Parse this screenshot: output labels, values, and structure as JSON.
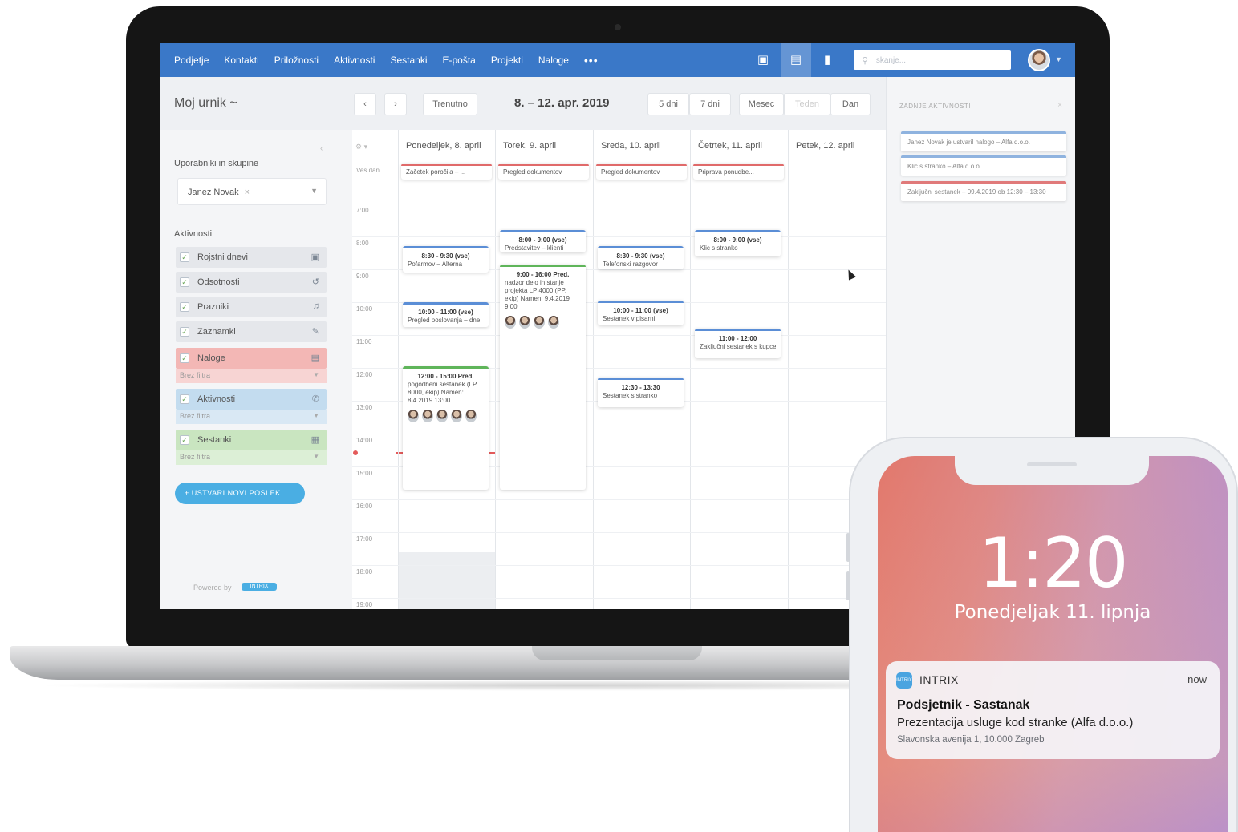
{
  "nav": {
    "items": [
      "Podjetje",
      "Kontakti",
      "Priložnosti",
      "Aktivnosti",
      "Sestanki",
      "E-pošta",
      "Projekti",
      "Naloge"
    ],
    "more": "•••",
    "search_placeholder": "Iskanje..."
  },
  "toolbar": {
    "title": "Moj urnik ~",
    "prev": "‹",
    "next": "›",
    "today": "Trenutno",
    "range": "8. – 12. apr. 2019",
    "views": [
      "5 dni",
      "7 dni",
      "Mesec",
      "Teden",
      "Dan"
    ]
  },
  "sidebar": {
    "users_heading": "Uporabniki in skupine",
    "collapse": "‹",
    "selected_user": "Janez Novak",
    "activities_heading": "Aktivnosti",
    "activities": [
      {
        "label": "Rojstni dnevi",
        "icon": "gift-icon",
        "glyph": "▣",
        "tone": "gray"
      },
      {
        "label": "Odsotnosti",
        "icon": "away-icon",
        "glyph": "↺",
        "tone": "gray"
      },
      {
        "label": "Prazniki",
        "icon": "holiday-icon",
        "glyph": "♫",
        "tone": "gray"
      },
      {
        "label": "Zaznamki",
        "icon": "bookmark-icon",
        "glyph": "✎",
        "tone": "gray"
      },
      {
        "label": "Naloge",
        "icon": "task-icon",
        "glyph": "▤",
        "tone": "red",
        "filter": "Brez filtra"
      },
      {
        "label": "Aktivnosti",
        "icon": "phone-icon",
        "glyph": "✆",
        "tone": "blue",
        "filter": "Brez filtra"
      },
      {
        "label": "Sestanki",
        "icon": "meeting-icon",
        "glyph": "▦",
        "tone": "green",
        "filter": "Brez filtra"
      }
    ],
    "new_task_button": "+ USTVARI NOVI POSLEK",
    "powered_by": "Powered by",
    "powered_badge": "INTRIX"
  },
  "calendar": {
    "allday_label": "Ves dan",
    "days": [
      "Ponedeljek, 8. april",
      "Torek, 9. april",
      "Sreda, 10. april",
      "Četrtek, 11. april",
      "Petek, 12. april"
    ],
    "hours": [
      "7:00",
      "8:00",
      "9:00",
      "10:00",
      "11:00",
      "12:00",
      "13:00",
      "14:00",
      "15:00",
      "16:00",
      "17:00",
      "18:00",
      "19:00"
    ],
    "allday_events": [
      {
        "day": 0,
        "text": "Začetek poročila – ..."
      },
      {
        "day": 1,
        "text": "Pregled dokumentov"
      },
      {
        "day": 2,
        "text": "Pregled dokumentov"
      },
      {
        "day": 3,
        "text": "Priprava ponudbe..."
      }
    ],
    "events": [
      {
        "day": 0,
        "time": "8:30 - 9:30 (vse)",
        "sub": "Pofarmov – Alterna",
        "tone": "blue",
        "start": 8.3,
        "end": 9.1
      },
      {
        "day": 0,
        "time": "10:00 - 11:00 (vse)",
        "sub": "Pregled poslovanja – dne",
        "tone": "blue",
        "start": 10.0,
        "end": 10.75
      },
      {
        "day": 0,
        "time": "12:00 - 15:00 Pred.",
        "sub": "pogodbeni sestanek (LP 8000, ekip) Namen: 8.4.2019 13:00",
        "tone": "green",
        "start": 11.95,
        "end": 15.7,
        "avatars": 5
      },
      {
        "day": 1,
        "time": "8:00 - 9:00 (vse)",
        "sub": "Predstavitev – klienti",
        "tone": "blue",
        "start": 7.8,
        "end": 8.5
      },
      {
        "day": 1,
        "time": "9:00 - 16:00 Pred.",
        "sub": "nadzor delo in stanje projekta LP 4000 (PP, ekip) Namen: 9.4.2019 9:00",
        "tone": "green",
        "start": 8.85,
        "end": 15.7,
        "avatars": 4
      },
      {
        "day": 2,
        "time": "8:30 - 9:30 (vse)",
        "sub": "Telefonski razgovor",
        "tone": "blue",
        "start": 8.3,
        "end": 9.0
      },
      {
        "day": 2,
        "time": "10:00 - 11:00 (vse)",
        "sub": "Sestanek v pisarni",
        "tone": "blue",
        "start": 9.95,
        "end": 10.7
      },
      {
        "day": 2,
        "time": "12:30 - 13:30",
        "sub": "Sestanek s stranko",
        "tone": "blue",
        "start": 12.3,
        "end": 13.2
      },
      {
        "day": 3,
        "time": "8:00 - 9:00 (vse)",
        "sub": "Klic s stranko",
        "tone": "blue",
        "start": 7.8,
        "end": 8.6
      },
      {
        "day": 3,
        "time": "11:00 - 12:00",
        "sub": "Zaključni sestanek s kupcem",
        "tone": "blue",
        "start": 10.8,
        "end": 11.7
      }
    ]
  },
  "right_panel": {
    "title": "ZADNJE AKTIVNOSTI",
    "close": "×",
    "items": [
      {
        "text": "Janez Novak je ustvaril nalogo – Alfa d.o.o.",
        "tone": "blue"
      },
      {
        "text": "Klic s stranko – Alfa d.o.o.",
        "tone": "blue"
      },
      {
        "text": "Zaključni sestanek – 09.4.2019 ob 12:30 – 13:30",
        "tone": "red"
      }
    ]
  },
  "phone": {
    "time": "1:20",
    "date": "Ponedjeljak 11. lipnja",
    "notification": {
      "app": "INTRIX",
      "when": "now",
      "title": "Podsjetnik - Sastanak",
      "body": "Prezentacija usluge kod stranke (Alfa d.o.o.)",
      "sub": "Slavonska avenija 1, 10.000 Zagreb"
    }
  },
  "colors": {
    "nav_blue": "#3a78c8",
    "task_red": "#e06a6a",
    "activity_blue": "#5b8ed6",
    "meeting_green": "#5fb55a",
    "accent": "#4aaee3"
  }
}
